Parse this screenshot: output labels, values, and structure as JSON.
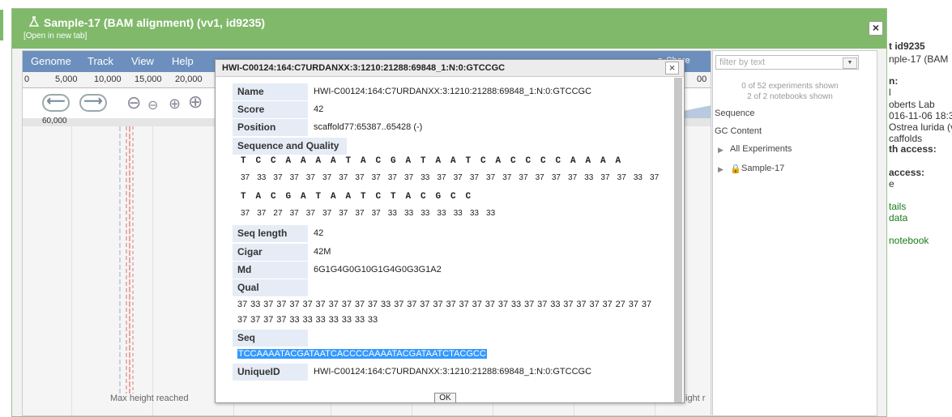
{
  "outer": {
    "title": "Sample-17 (BAM alignment) (vv1, id9235)",
    "open_link": "[Open in new tab]",
    "close": "×"
  },
  "menu": [
    "Genome",
    "Track",
    "View",
    "Help"
  ],
  "share_label": "Share",
  "ruler_ticks": [
    "0",
    "5,000",
    "10,000",
    "15,000",
    "20,000"
  ],
  "ruler_right": "00",
  "overview_tick": "60,000",
  "max_height_label": "Max height reached",
  "max_height_right": "ight r",
  "side": {
    "filter_placeholder": "filter by text",
    "experiments_info": "0 of 52 experiments shown",
    "notebooks_info": "2 of 2 notebooks shown",
    "categories": [
      "Sequence",
      "GC Content"
    ],
    "tree": [
      "All Experiments",
      "Sample-17"
    ]
  },
  "modal": {
    "title": "HWI-C00124:164:C7URDANXX:3:1210:21288:69848_1:N:0:GTCCGC",
    "close": "×",
    "name_label": "Name",
    "name": "HWI-C00124:164:C7URDANXX:3:1210:21288:69848_1:N:0:GTCCGC",
    "score_label": "Score",
    "score": "42",
    "position_label": "Position",
    "position": "scaffold77:65387..65428 (-)",
    "seqqual_label": "Sequence and Quality",
    "seq_line1": "TCCAAAATACGATAATCACCCCAAAA",
    "qual_line1": "37 33 37 37 37 37 37 37 37 37 37 33 37 37 37 37 37 37 37 37 37 33 37 37 33 37",
    "seq_line2": "TACGATAATCTACGCC",
    "qual_line2": "37 37 27 37 37 37 37 37 37 33 33 33 33 33 33 33",
    "seqlen_label": "Seq length",
    "seqlen": "42",
    "cigar_label": "Cigar",
    "cigar": "42M",
    "md_label": "Md",
    "md": "6G1G4G0G10G1G4G0G3G1A2",
    "qual_label": "Qual",
    "qual": "37 33 37 37 37 37 37 37 37 37 37 33 37 37 37 37 37 37 37 37 37 33 37 37 33 37 37 37 37 27 37 37 37 37 37 37 33 33 33 33 33 33 33",
    "seq_label": "Seq",
    "seq": "TCCAAAATACGATAATCACCCCAAAATACGATAATCTACGCC",
    "uid_label": "UniqueID",
    "uid": "HWI-C00124:164:C7URDANXX:3:1210:21288:69848_1:N:0:GTCCGC",
    "ok": "OK"
  },
  "background_right": {
    "l1": "t id9235",
    "l2": "nple-17 (BAM",
    "l3": "n:",
    "l4": "l",
    "l5": "oberts Lab",
    "l6": "016-11-06 18:3",
    "l7": "Ostrea lurida (v",
    "l8": "caffolds",
    "l9": "th access:",
    "l10": "access:",
    "l11": "e",
    "l12": "tails",
    "l13": "data",
    "l14": "notebook"
  },
  "colors": {
    "header_green": "#80b96a",
    "menu_blue": "#6c8fbd",
    "label_bg": "#e6ecf6",
    "selection": "#3399ff"
  }
}
